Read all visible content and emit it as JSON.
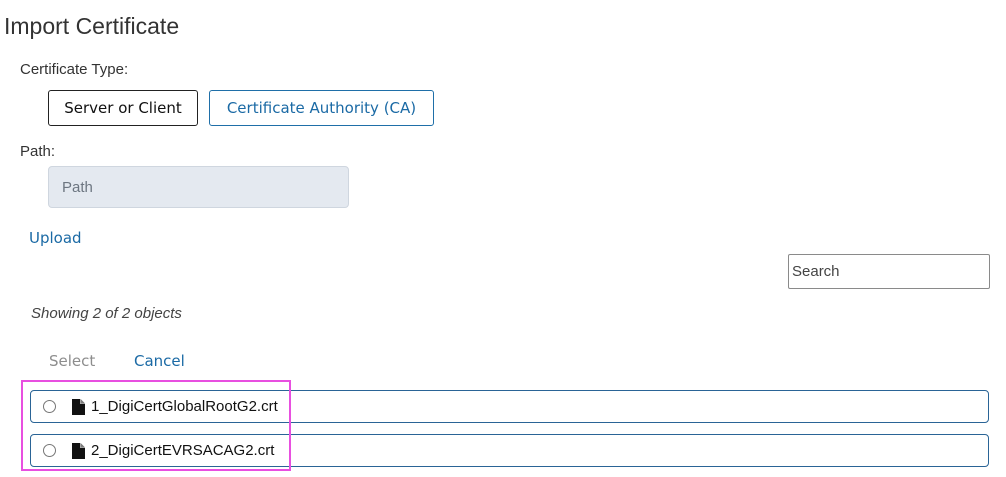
{
  "page": {
    "title": "Import Certificate"
  },
  "certificate_type": {
    "label": "Certificate Type:",
    "options": [
      {
        "label": "Server or Client",
        "selected": true
      },
      {
        "label": "Certificate Authority (CA)",
        "selected": false
      }
    ]
  },
  "path": {
    "label": "Path:",
    "placeholder": "Path",
    "value": ""
  },
  "upload": {
    "label": "Upload"
  },
  "search": {
    "placeholder": "Search",
    "value": ""
  },
  "listing": {
    "count_text": "Showing 2 of 2 objects",
    "select_label": "Select",
    "cancel_label": "Cancel",
    "files": [
      {
        "name": "1_DigiCertGlobalRootG2.crt",
        "icon": "file-icon"
      },
      {
        "name": "2_DigiCertEVRSACAG2.crt",
        "icon": "file-icon"
      }
    ]
  },
  "colors": {
    "link": "#1b6aa5",
    "row_border": "#2a6496",
    "highlight": "#e84fe0",
    "input_bg": "#e4e9f0"
  }
}
